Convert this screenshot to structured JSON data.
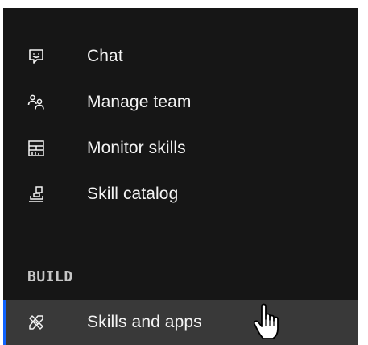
{
  "nav": {
    "items": [
      {
        "label": "Chat",
        "icon": "chat-bubble-icon"
      },
      {
        "label": "Manage team",
        "icon": "user-group-icon"
      },
      {
        "label": "Monitor skills",
        "icon": "dashboard-chart-icon"
      },
      {
        "label": "Skill catalog",
        "icon": "catalog-icon"
      }
    ]
  },
  "build": {
    "heading": "BUILD",
    "items": [
      {
        "label": "Skills and apps",
        "icon": "tools-icon",
        "active": true
      }
    ]
  },
  "colors": {
    "panel_bg": "#161616",
    "active_bg": "#393939",
    "active_indicator": "#0f62fe",
    "text": "#f4f4f4",
    "heading_text": "#c6c6c6"
  },
  "cursor": {
    "type": "hand-pointer"
  }
}
